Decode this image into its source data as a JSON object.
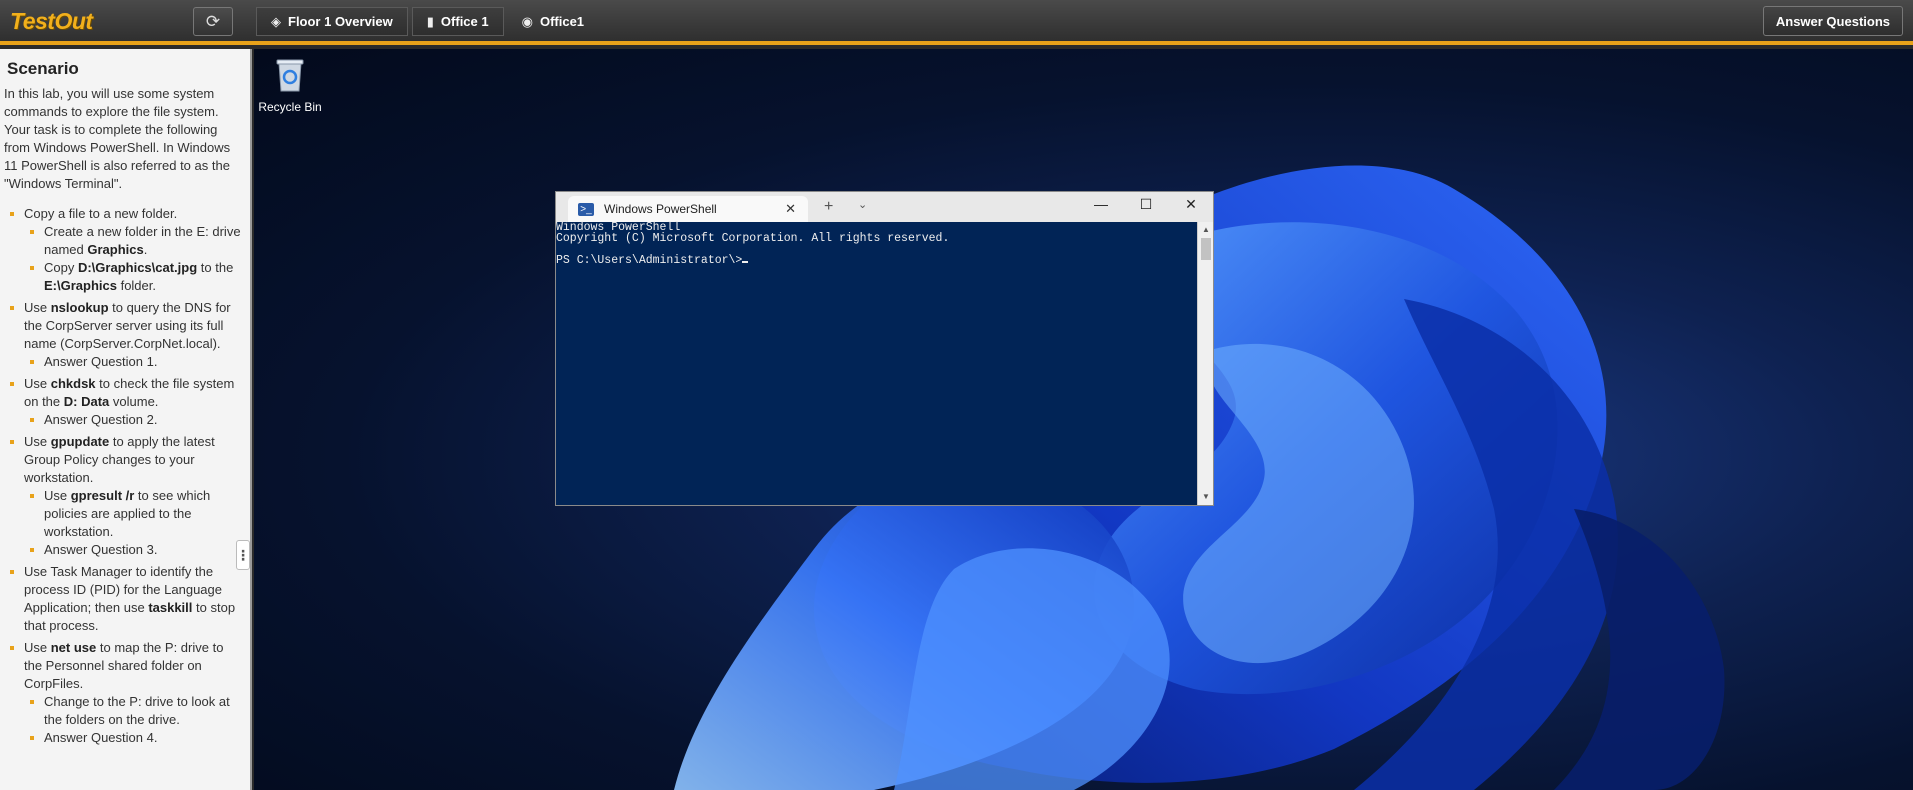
{
  "header": {
    "logo": "TestOut",
    "refresh_icon": "refresh-icon",
    "breadcrumbs": [
      {
        "label": "Floor 1 Overview",
        "icon": "layers-icon"
      },
      {
        "label": "Office 1",
        "icon": "building-icon"
      },
      {
        "label": "Office1",
        "icon": "computer-icon"
      }
    ],
    "answer_button": "Answer Questions"
  },
  "scenario": {
    "title": "Scenario",
    "intro": "In this lab, you will use some system commands to explore the file system. Your task is to complete the following from Windows PowerShell. In Windows 11 PowerShell is also referred to as the \"Windows Terminal\".",
    "tasks": [
      {
        "text": "Copy a file to a new folder.",
        "sub": [
          {
            "pre": "Create a new folder in the E: drive named ",
            "bold": "Graphics",
            "post": "."
          },
          {
            "pre": "Copy ",
            "bold": "D:\\Graphics\\cat.jpg",
            "mid": " to the ",
            "bold2": "E:\\Graphics",
            "post": " folder."
          }
        ]
      },
      {
        "pre": "Use ",
        "bold": "nslookup",
        "post": " to query the DNS for the CorpServer server using its full name (CorpServer.CorpNet.local).",
        "sub": [
          {
            "pre": "Answer Question 1."
          }
        ]
      },
      {
        "pre": "Use ",
        "bold": "chkdsk",
        "post": " to check the file system on the ",
        "bold2": "D: Data",
        "post2": " volume.",
        "sub": [
          {
            "pre": "Answer Question 2."
          }
        ]
      },
      {
        "pre": "Use ",
        "bold": "gpupdate",
        "post": " to apply the latest Group Policy changes to your workstation.",
        "sub": [
          {
            "pre": "Use ",
            "bold": "gpresult /r",
            "post": " to see which policies are applied to the workstation."
          },
          {
            "pre": "Answer Question 3."
          }
        ]
      },
      {
        "pre": "Use Task Manager to identify the process ID (PID) for the Language Application; then use ",
        "bold": "taskkill",
        "post": " to stop that process."
      },
      {
        "pre": "Use ",
        "bold": "net use",
        "post": " to map the P: drive to the Personnel shared folder on CorpFiles.",
        "sub": [
          {
            "pre": "Change to the P: drive to look at the folders on the drive."
          },
          {
            "pre": "Answer Question 4."
          }
        ]
      }
    ]
  },
  "desktop": {
    "recycle_bin_label": "Recycle Bin"
  },
  "powershell": {
    "tab_title": "Windows PowerShell",
    "new_tab": "+",
    "dropdown": "⌄",
    "minimize": "—",
    "maximize": "☐",
    "close": "✕",
    "lines": [
      "Windows PowerShell",
      "Copyright (C) Microsoft Corporation. All rights reserved.",
      "",
      "PS C:\\Users\\Administrator\\>"
    ]
  },
  "colors": {
    "accent": "#e8a21a",
    "console_bg": "#012456"
  }
}
